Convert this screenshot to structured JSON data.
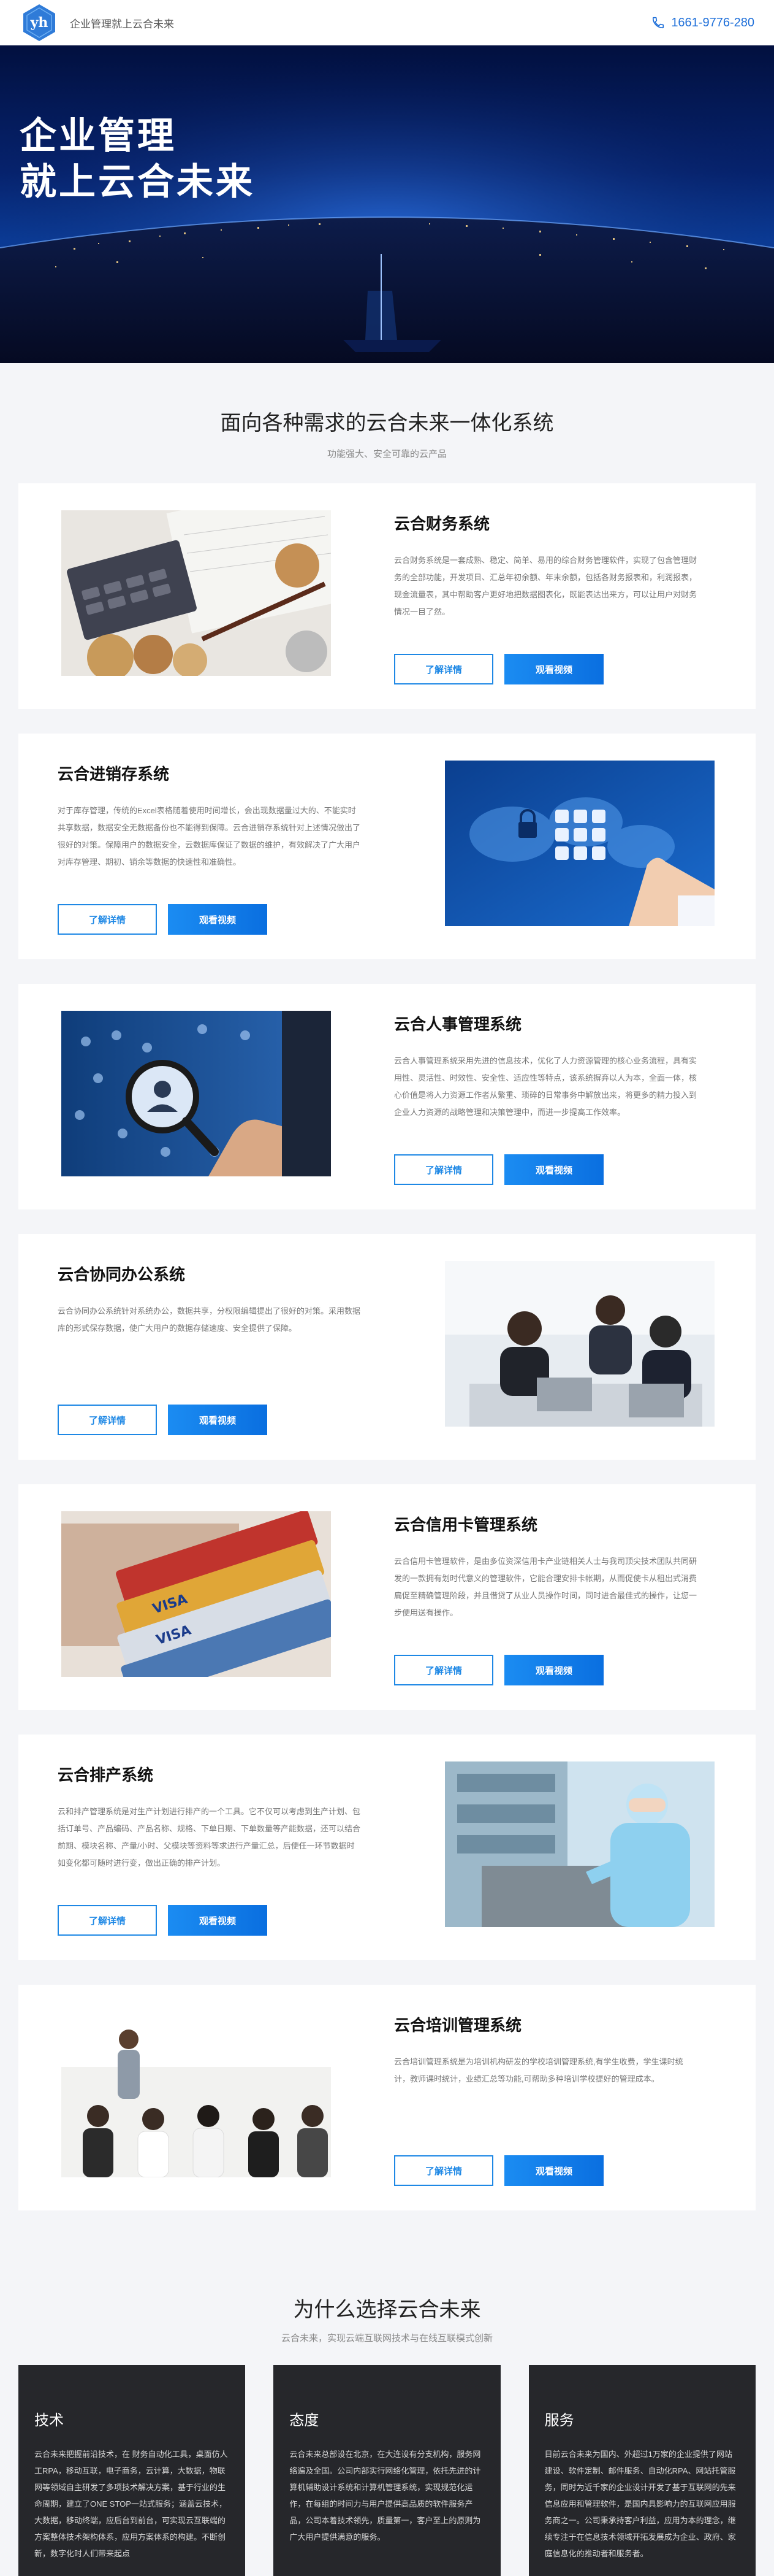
{
  "header": {
    "logo_text": "yh",
    "slogan": "企业管理就上云合未来",
    "phone": "1661-9776-280"
  },
  "hero": {
    "line1": "企业管理",
    "line2": "就上云合未来"
  },
  "systems": {
    "title": "面向各种需求的云合未来一体化系统",
    "subtitle": "功能强大、安全可靠的云产品",
    "items": [
      {
        "title": "云合财务系统",
        "desc": "云合财务系统是一套成熟、稳定、简单、易用的综合财务管理软件，实现了包含管理财务的全部功能，开发项目、汇总年初余额、年末余额，包括各财务报表和，利润报表，现金流量表，其中帮助客户更好地把数据图表化，既能表达出来方，可以让用户对财务情况一目了然。",
        "detail_label": "了解详情",
        "video_label": "观看视频"
      },
      {
        "title": "云合进销存系统",
        "desc": "对于库存管理，传统的Excel表格随着使用时间增长，会出现数据量过大的、不能实时共享数据，数据安全无数据备份也不能得到保障。云合进销存系统针对上述情况做出了很好的对策。保障用户的数据安全，云数据库保证了数据的维护，有效解决了广大用户对库存管理、期初、销余等数据的快速性和准确性。",
        "detail_label": "了解详情",
        "video_label": "观看视频"
      },
      {
        "title": "云合人事管理系统",
        "desc": "云合人事管理系统采用先进的信息技术，优化了人力资源管理的核心业务流程，具有实用性、灵活性、时效性、安全性、适应性等特点，该系统摒弃以人为本，全面一体，核心价值是将人力资源工作者从繁重、琐碎的日常事务中解放出来，将更多的精力投入到企业人力资源的战略管理和决策管理中，而进一步提高工作效率。",
        "detail_label": "了解详情",
        "video_label": "观看视频"
      },
      {
        "title": "云合协同办公系统",
        "desc": "云合协同办公系统针对系统办公，数据共享，分权限编辑提出了很好的对策。采用数据库的形式保存数据，使广大用户的数据存储速度、安全提供了保障。",
        "detail_label": "了解详情",
        "video_label": "观看视频"
      },
      {
        "title": "云合信用卡管理系统",
        "desc": "云合信用卡管理软件，是由多位资深信用卡产业链相关人士与我司顶尖技术团队共同研发的一款拥有划时代意义的管理软件，它能合理安排卡帐期，从而促使卡从租出式消费扁促至精确管理阶段，并且借贷了从业人员操作时间，同时进合最佳式的操作，让您一步使用送有操作。",
        "detail_label": "了解详情",
        "video_label": "观看视频"
      },
      {
        "title": "云合排产系统",
        "desc": "云和排产管理系统是对生产计划进行排产的一个工具。它不仅可以考虑到生产计划、包括订单号、产品编码、产品名称、规格、下单日期、下单数量等产能数据，还可以结合前期、模块名称、产量/小时、父模块等资料等求进行产量汇总，后使任一环节数据时如变化都可随时进行变，做出正确的排产计划。",
        "detail_label": "了解详情",
        "video_label": "观看视频"
      },
      {
        "title": "云合培训管理系统",
        "desc": "云合培训管理系统是为培训机构研发的学校培训管理系统,有学生收费，学生课时统计，教师课时统计，业绩汇总等功能,可帮助多种培训学校提好的管理成本。",
        "detail_label": "了解详情",
        "video_label": "观看视频"
      }
    ]
  },
  "why": {
    "title": "为什么选择云合未来",
    "subtitle": "云合未来，实现云端互联网技术与在线互联模式创新",
    "cards": [
      {
        "title": "技术",
        "desc": "云合未来把握前沿技术，在 财务自动化工具，桌面仿人工RPA，移动互联，电子商务，云计算，大数据，物联网等领域自主研发了多项技术解决方案，基于行业的生命周期，建立了ONE STOP一站式服务；涵盖云技术，大数据，移动终端，应后台到前台，可实现云互联端的方案整体技术架构体系，应用方案体系的构建。不断创新，数字化时人们带来起点"
      },
      {
        "title": "态度",
        "desc": "云合未来总部设在北京，在大连设有分支机构，服务网络遍及全国。公司内部实行网络化管理，依托先进的计算机辅助设计系统和计算机管理系统，实现规范化运作，在每组的时间力与用户提供高品质的软件服务产品，公司本着技术领先，质量第一，客户至上的原则为广大用户提供满意的服务。"
      },
      {
        "title": "服务",
        "desc": "目前云合未来为国内、外超过1万家的企业提供了网站建设、软件定制、邮件服务、自动化RPA、网站托管服务，同时为近千家的企业设计开发了基于互联网的先来信息应用和管理软件，是国内具影响力的互联网应用服务商之一。公司秉承持客户利益，应用为本的理念，继续专注于在信息技术领域开拓发展成为企业、政府、家庭信息化的推动者和服务者。"
      }
    ]
  },
  "colors": {
    "accent": "#1e88e5",
    "dark_card": "#26272b"
  }
}
